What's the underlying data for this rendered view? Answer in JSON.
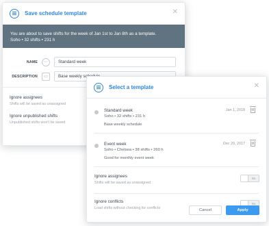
{
  "save_modal": {
    "title": "Save schedule template",
    "close_icon": "close-icon",
    "banner_line1": "You are about to save shifts for the week of Jan 1st to Jan 8th as a template.",
    "banner_line2": "Soho • 32 shifts • 231 h",
    "fields": [
      {
        "label": "NAME",
        "icon": "tag-icon",
        "value": "Standard week"
      },
      {
        "label": "DESCRIPTION",
        "icon": "comment-icon",
        "value": "Base weekly schedule"
      }
    ],
    "options": [
      {
        "title": "Ignore assignees",
        "subtitle": "Shifts will be saved as unassigned"
      },
      {
        "title": "Ignore unpublished shifts",
        "subtitle": "Unpublished shifts won't be saved"
      }
    ]
  },
  "select_modal": {
    "title": "Select a template",
    "close_icon": "close-icon",
    "templates": [
      {
        "name": "Standard week",
        "meta": "Soho • 32 shifts • 231 h",
        "description": "Base weekly schedule",
        "date": "Jan 1, 2018",
        "icon": "trash-icon"
      },
      {
        "name": "Event week",
        "meta": "Soho • Chelsea • 38 shifts • 260 h",
        "description": "Good for monthly event week",
        "date": "Dec 20, 2017",
        "icon": "trash-icon"
      }
    ],
    "toggles": [
      {
        "title": "Ignore assignees",
        "subtitle": "Shifts will be saved as unassigned",
        "state": "No"
      },
      {
        "title": "Ignore conflicts",
        "subtitle": "Load shifts without checking for conflicts",
        "state": "No"
      }
    ],
    "cancel_label": "Cancel",
    "apply_label": "Apply"
  },
  "colors": {
    "brand_blue": "#2f86d8",
    "apply_blue": "#3c9bf0",
    "banner_gray": "#5f7380"
  }
}
